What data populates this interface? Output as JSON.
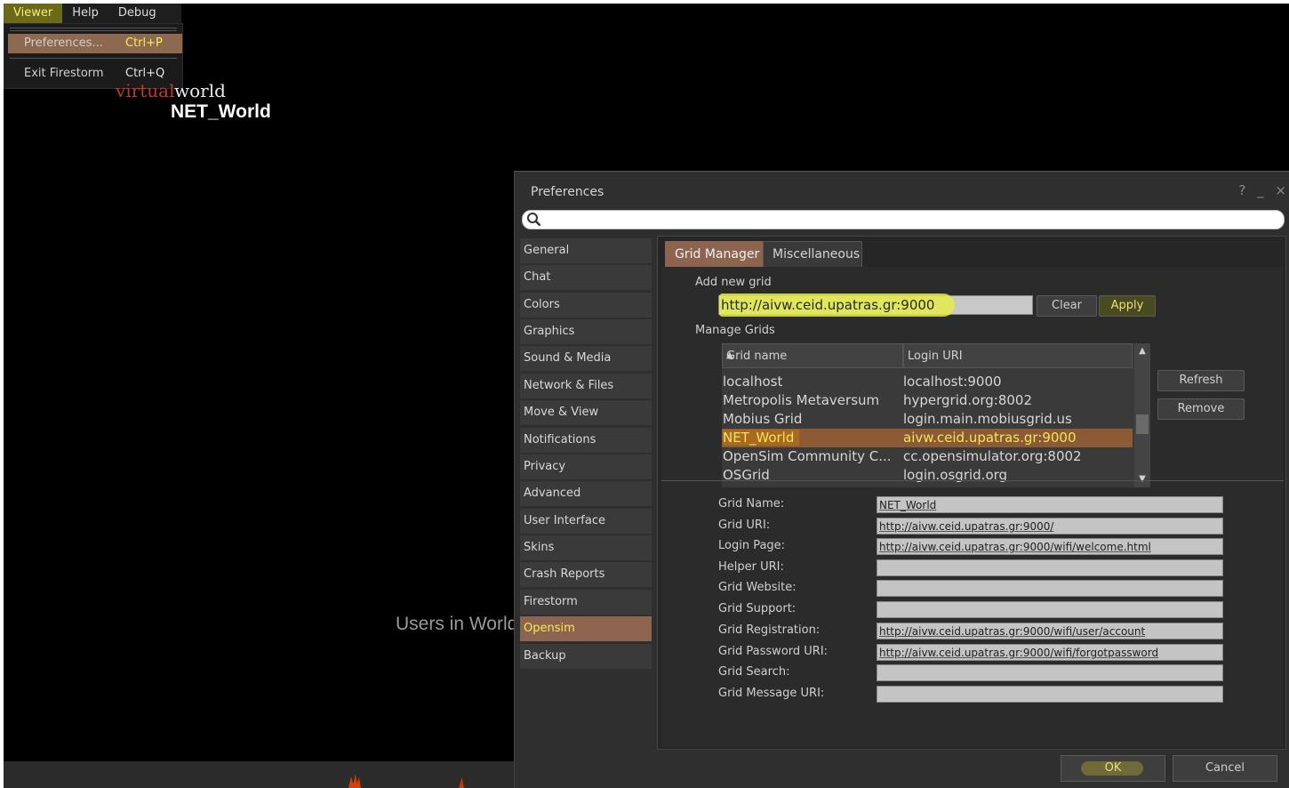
{
  "menubar": {
    "items": [
      "Viewer",
      "Help",
      "Debug"
    ],
    "dropdown": [
      {
        "label": "Preferences...",
        "shortcut": "Ctrl+P"
      },
      {
        "label": "Exit Firestorm",
        "shortcut": "Ctrl+Q"
      }
    ]
  },
  "background": {
    "virtual": "virtual",
    "world": "world",
    "grid_title": "NET_World",
    "users_in_world": "Users in World"
  },
  "preferences": {
    "title": "Preferences",
    "title_buttons": [
      "?",
      "_",
      "×"
    ],
    "categories": [
      "General",
      "Chat",
      "Colors",
      "Graphics",
      "Sound & Media",
      "Network & Files",
      "Move & View",
      "Notifications",
      "Privacy",
      "Advanced",
      "User Interface",
      "Skins",
      "Crash Reports",
      "Firestorm",
      "Opensim",
      "Backup"
    ],
    "active_category": "Opensim",
    "tabs": [
      "Grid Manager",
      "Miscellaneous"
    ],
    "add_new_grid_label": "Add new grid",
    "add_new_grid_value": "http://aivw.ceid.upatras.gr:9000",
    "clear_label": "Clear",
    "apply_label": "Apply",
    "manage_grids_label": "Manage Grids",
    "grid_list": {
      "headers": [
        "Grid name",
        "Login URI"
      ],
      "rows": [
        {
          "name": "localhost",
          "uri": "localhost:9000"
        },
        {
          "name": "Metropolis Metaversum",
          "uri": "hypergrid.org:8002"
        },
        {
          "name": "Mobius Grid",
          "uri": "login.main.mobiusgrid.us"
        },
        {
          "name": "NET_World",
          "uri": "aivw.ceid.upatras.gr:9000"
        },
        {
          "name": "OpenSim Community C...",
          "uri": "cc.opensimulator.org:8002"
        },
        {
          "name": "OSGrid",
          "uri": "login.osgrid.org"
        }
      ],
      "selected": "NET_World"
    },
    "refresh_label": "Refresh",
    "remove_label": "Remove",
    "fields": [
      {
        "label": "Grid Name:",
        "value": "NET_World"
      },
      {
        "label": "Grid URI:",
        "value": "http://aivw.ceid.upatras.gr:9000/"
      },
      {
        "label": "Login Page:",
        "value": "http://aivw.ceid.upatras.gr:9000/wifi/welcome.html"
      },
      {
        "label": "Helper URI:",
        "value": ""
      },
      {
        "label": "Grid Website:",
        "value": ""
      },
      {
        "label": "Grid Support:",
        "value": ""
      },
      {
        "label": "Grid Registration:",
        "value": "http://aivw.ceid.upatras.gr:9000/wifi/user/account"
      },
      {
        "label": "Grid Password URI:",
        "value": "http://aivw.ceid.upatras.gr:9000/wifi/forgotpassword"
      },
      {
        "label": "Grid Search:",
        "value": ""
      },
      {
        "label": "Grid Message URI:",
        "value": ""
      }
    ],
    "ok_label": "OK",
    "cancel_label": "Cancel"
  },
  "colors": {
    "highlight": "#8d6450",
    "accent_yellow": "#f2ec52"
  }
}
